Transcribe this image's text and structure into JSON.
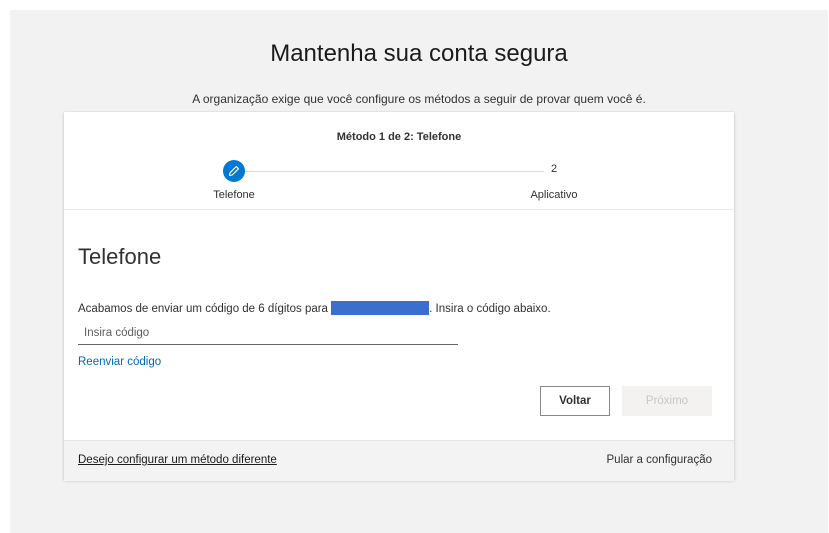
{
  "header": {
    "title": "Mantenha sua conta segura",
    "subtitle": "A organização exige que você configure os métodos a seguir de provar quem você é."
  },
  "progress": {
    "title": "Método 1 de 2: Telefone",
    "steps": [
      {
        "label": "Telefone",
        "icon": "pencil-icon",
        "state": "current"
      },
      {
        "number": "2",
        "label": "Aplicativo",
        "state": "pending"
      }
    ]
  },
  "main": {
    "heading": "Telefone",
    "instruction_before": "Acabamos de enviar um código de 6 dígitos para",
    "instruction_after": ". Insira o código abaixo.",
    "code_input": {
      "placeholder": "Insira código",
      "value": ""
    },
    "resend_label": "Reenviar código",
    "back_label": "Voltar",
    "next_label": "Próximo"
  },
  "footer": {
    "different_method_label": "Desejo configurar um método diferente",
    "skip_label": "Pular a configuração"
  },
  "colors": {
    "accent": "#0078d4",
    "link": "#0067b8",
    "redaction": "#3a6fd0",
    "disabled_bg": "#f3f2f1"
  }
}
